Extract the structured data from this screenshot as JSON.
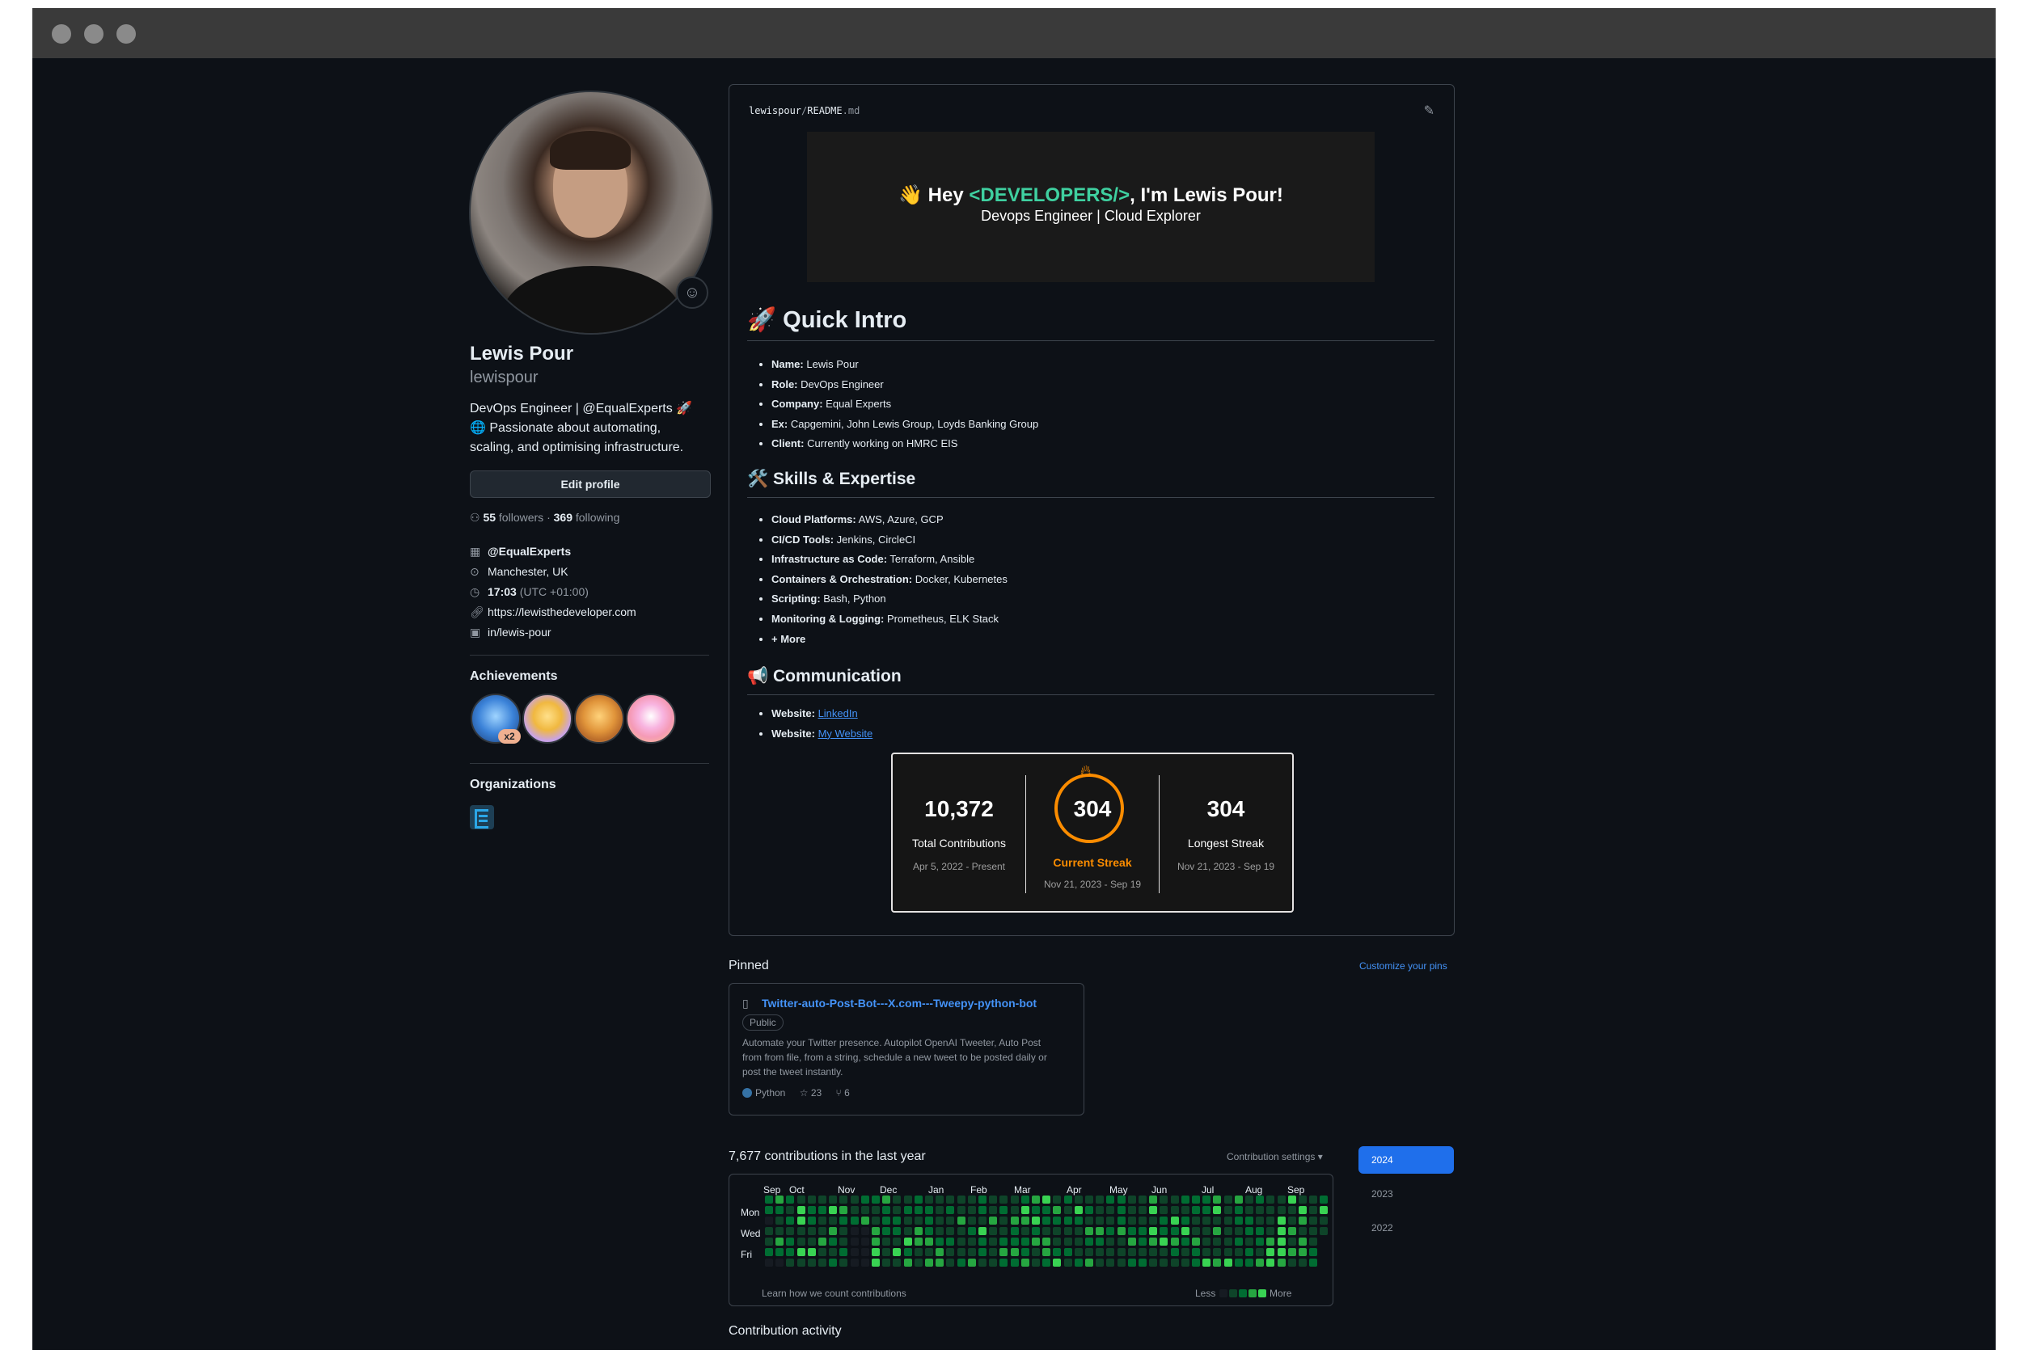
{
  "profile": {
    "name": "Lewis Pour",
    "login": "lewispour",
    "bio_line1": "DevOps Engineer | @EqualExperts 🚀",
    "bio_line2": "🌐 Passionate about automating,",
    "bio_line3": "scaling, and optimising infrastructure.",
    "edit_label": "Edit profile",
    "followers_count": "55",
    "followers_label": "followers",
    "sep": "·",
    "following_count": "369",
    "following_label": "following",
    "company": "@EqualExperts",
    "location": "Manchester, UK",
    "time": "17:03",
    "timezone": "(UTC +01:00)",
    "website": "https://lewisthedeveloper.com",
    "linkedin": "in/lewis-pour",
    "achievements_title": "Achievements",
    "achievement_multiplier": "x2",
    "organizations_title": "Organizations"
  },
  "readme": {
    "owner": "lewispour",
    "slash": "/",
    "file": "README",
    "ext": ".md",
    "banner_pre": "👋 Hey ",
    "banner_dev": "<DEVELOPERS/>",
    "banner_post": ", I'm Lewis Pour!",
    "banner_sub": "Devops Engineer | Cloud Explorer",
    "intro_title": "🚀 Quick Intro",
    "intro": [
      {
        "k": "Name:",
        "v": " Lewis Pour"
      },
      {
        "k": "Role:",
        "v": " DevOps Engineer"
      },
      {
        "k": "Company:",
        "v": " Equal Experts"
      },
      {
        "k": "Ex:",
        "v": " Capgemini, John Lewis Group, Loyds Banking Group"
      },
      {
        "k": "Client:",
        "v": " Currently working on HMRC EIS"
      }
    ],
    "skills_title": "🛠️ Skills & Expertise",
    "skills": [
      {
        "k": "Cloud Platforms:",
        "v": " AWS, Azure, GCP"
      },
      {
        "k": "CI/CD Tools:",
        "v": " Jenkins, CircleCI"
      },
      {
        "k": "Infrastructure as Code:",
        "v": " Terraform, Ansible"
      },
      {
        "k": "Containers & Orchestration:",
        "v": " Docker, Kubernetes"
      },
      {
        "k": "Scripting:",
        "v": " Bash, Python"
      },
      {
        "k": "Monitoring & Logging:",
        "v": " Prometheus, ELK Stack"
      },
      {
        "k": "+ More",
        "v": ""
      }
    ],
    "comm_title": "📢 Communication",
    "comm": [
      {
        "k": "Website:",
        "link": "LinkedIn"
      },
      {
        "k": "Website:",
        "link": "My Website"
      }
    ],
    "stats": {
      "total": "10,372",
      "total_label": "Total Contributions",
      "total_range": "Apr 5, 2022 - Present",
      "current": "304",
      "current_label": "Current Streak",
      "current_range": "Nov 21, 2023 - Sep 19",
      "longest": "304",
      "longest_label": "Longest Streak",
      "longest_range": "Nov 21, 2023 - Sep 19",
      "accent": "#fb8c00"
    }
  },
  "pinned": {
    "title": "Pinned",
    "customize": "Customize your pins",
    "repo": {
      "name": "Twitter-auto-Post-Bot---X.com---Tweepy-python-bot",
      "visibility": "Public",
      "desc1": "Automate your Twitter presence. Autopilot OpenAI Tweeter, Auto Post",
      "desc2": "from from file, from a string, schedule a new tweet to be posted daily or",
      "desc3": "post the tweet instantly.",
      "language": "Python",
      "language_color": "#3572A5",
      "stars": "23",
      "forks": "6"
    }
  },
  "contributions": {
    "title": "7,677 contributions in the last year",
    "settings": "Contribution settings ▾",
    "months": [
      "Sep",
      "Oct",
      "Nov",
      "Dec",
      "Jan",
      "Feb",
      "Mar",
      "Apr",
      "May",
      "Jun",
      "Jul",
      "Aug",
      "Sep"
    ],
    "days": [
      "Mon",
      "Wed",
      "Fri"
    ],
    "learn": "Learn how we count contributions",
    "less": "Less",
    "more": "More",
    "colors": [
      "#161b22",
      "#0e4429",
      "#006d32",
      "#26a641",
      "#39d353"
    ],
    "years": [
      "2024",
      "2023",
      "2022"
    ],
    "selected_year": "2024",
    "activity_title": "Contribution activity"
  }
}
